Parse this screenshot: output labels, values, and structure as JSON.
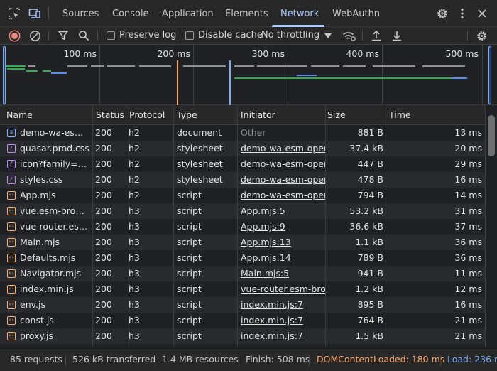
{
  "tabs": {
    "sources": "Sources",
    "console": "Console",
    "application": "Application",
    "elements": "Elements",
    "network": "Network",
    "webauthn": "WebAuthn"
  },
  "toolbar": {
    "preserve_log": "Preserve log",
    "disable_cache": "Disable cache",
    "throttling": "No throttling"
  },
  "overview": {
    "ticks": [
      "100 ms",
      "200 ms",
      "300 ms",
      "400 ms",
      "500 ms"
    ]
  },
  "table": {
    "headers": {
      "name": "Name",
      "status": "Status",
      "protocol": "Protocol",
      "type": "Type",
      "initiator": "Initiator",
      "size": "Size",
      "time": "Time"
    },
    "rows": [
      {
        "name": "demo-wa-esm-openapi.html",
        "status": "200",
        "protocol": "h2",
        "type": "document",
        "initiator": "Other",
        "size": "881 B",
        "time": "13 ms"
      },
      {
        "name": "quasar.prod.css",
        "status": "200",
        "protocol": "h2",
        "type": "stylesheet",
        "initiator": "demo-wa-esm-openapi.html",
        "size": "37.4 kB",
        "time": "20 ms"
      },
      {
        "name": "icon?family=Material+Icons",
        "status": "200",
        "protocol": "h2",
        "type": "stylesheet",
        "initiator": "demo-wa-esm-openapi.html",
        "size": "447 B",
        "time": "29 ms"
      },
      {
        "name": "styles.css",
        "status": "200",
        "protocol": "h2",
        "type": "stylesheet",
        "initiator": "demo-wa-esm-openapi.html",
        "size": "478 B",
        "time": "16 ms"
      },
      {
        "name": "App.mjs",
        "status": "200",
        "protocol": "h2",
        "type": "script",
        "initiator": "demo-wa-esm-openapi.html",
        "size": "794 B",
        "time": "14 ms"
      },
      {
        "name": "vue.esm-browser.prod.js",
        "status": "200",
        "protocol": "h3",
        "type": "script",
        "initiator": "App.mjs:5",
        "size": "53.2 kB",
        "time": "31 ms"
      },
      {
        "name": "vue-router.esm-browser.js",
        "status": "200",
        "protocol": "h3",
        "type": "script",
        "initiator": "App.mjs:9",
        "size": "36.6 kB",
        "time": "37 ms"
      },
      {
        "name": "Main.mjs",
        "status": "200",
        "protocol": "h3",
        "type": "script",
        "initiator": "App.mjs:13",
        "size": "1.1 kB",
        "time": "36 ms"
      },
      {
        "name": "Defaults.mjs",
        "status": "200",
        "protocol": "h3",
        "type": "script",
        "initiator": "App.mjs:14",
        "size": "789 B",
        "time": "36 ms"
      },
      {
        "name": "Navigator.mjs",
        "status": "200",
        "protocol": "h3",
        "type": "script",
        "initiator": "Main.mjs:5",
        "size": "941 B",
        "time": "11 ms"
      },
      {
        "name": "index.min.js",
        "status": "200",
        "protocol": "h3",
        "type": "script",
        "initiator": "vue-router.esm-browser.js",
        "size": "1.2 kB",
        "time": "12 ms"
      },
      {
        "name": "env.js",
        "status": "200",
        "protocol": "h3",
        "type": "script",
        "initiator": "index.min.js:7",
        "size": "895 B",
        "time": "16 ms"
      },
      {
        "name": "const.js",
        "status": "200",
        "protocol": "h3",
        "type": "script",
        "initiator": "index.min.js:7",
        "size": "764 B",
        "time": "21 ms"
      },
      {
        "name": "proxy.js",
        "status": "200",
        "protocol": "h3",
        "type": "script",
        "initiator": "index.min.js:7",
        "size": "1.5 kB",
        "time": "21 ms"
      }
    ]
  },
  "status": {
    "requests": "85 requests",
    "transferred": "526 kB transferred",
    "resources": "1.4 MB resources",
    "finish": "Finish: 508 ms",
    "domcontentloaded": "DOMContentLoaded: 180 ms",
    "load": "Load: 236 ms"
  },
  "colors": {
    "accent": "#a8c7fa",
    "record": "#f28b82",
    "domcontentloaded": "#f9a66c",
    "load": "#7cacf8",
    "waterfall_green": "#34a853",
    "waterfall_blue": "#5b8def"
  },
  "icons": {
    "inspect": "element-picker-icon",
    "device": "device-toggle-icon",
    "settings": "gear-icon",
    "more": "kebab-menu-icon",
    "close": "close-icon",
    "record": "record-icon",
    "clear": "clear-icon",
    "filter": "filter-icon",
    "search": "search-icon",
    "network_conditions": "wifi-icon",
    "upload": "import-icon",
    "download": "export-icon",
    "file_types": {
      "document": "document-icon",
      "stylesheet": "stylesheet-icon",
      "script": "script-icon"
    }
  }
}
